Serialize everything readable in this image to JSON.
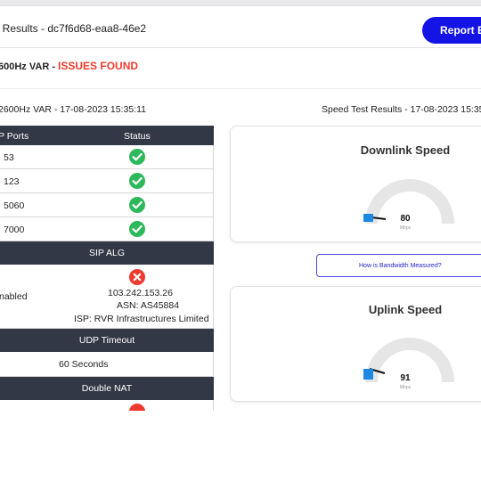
{
  "header": {
    "title": "t Results - dc7f6d68-eaa8-46e2",
    "report_button": "Report Er"
  },
  "status": {
    "device": "600Hz VAR - ",
    "issues": "ISSUES FOUND",
    "issues_color": "#ef3b2c"
  },
  "timestamps": {
    "left": "2600Hz VAR - 17-08-2023 15:35:11",
    "right": "Speed Test Results - 17-08-2023 15:35:1"
  },
  "ports_table": {
    "headers": [
      "P Ports",
      "Status"
    ],
    "rows": [
      {
        "port": "53",
        "status": "ok"
      },
      {
        "port": "123",
        "status": "ok"
      },
      {
        "port": "5060",
        "status": "ok"
      },
      {
        "port": "7000",
        "status": "ok"
      }
    ]
  },
  "sip_alg": {
    "title": "SIP ALG",
    "left_value": "nabled",
    "ip": "103.242.153.26",
    "asn": "ASN: AS45884",
    "isp": "ISP: RVR Infrastructures Limited"
  },
  "udp_timeout": {
    "title": "UDP Timeout",
    "value": "60 Seconds"
  },
  "double_nat": {
    "title": "Double NAT"
  },
  "downlink": {
    "title": "Downlink Speed",
    "value": "80",
    "unit": "Mbps"
  },
  "uplink": {
    "title": "Uplink Speed",
    "value": "91",
    "unit": "Mbps"
  },
  "bandwidth_link": "How is Bandwidth Measured?",
  "colors": {
    "accent": "#1414e6",
    "ok": "#2db85b",
    "error": "#ee3a2f",
    "table_header": "#333846",
    "gauge_track": "#e6e6e6",
    "gauge_needle_base": "#1e88e5"
  }
}
